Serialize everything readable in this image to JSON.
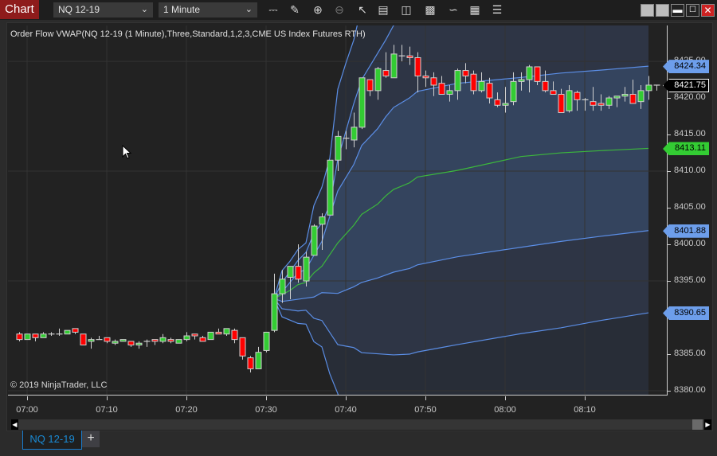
{
  "toolbar": {
    "chart_label": "Chart",
    "instrument": "NQ 12-19",
    "interval": "1 Minute",
    "icons": [
      "bar-type-icon",
      "drawing-tool-icon",
      "zoom-in-icon",
      "zoom-out-icon",
      "pointer-icon",
      "data-box-icon",
      "chart-trader-icon",
      "indicators-icon",
      "strategies-icon",
      "templates-icon",
      "properties-icon"
    ],
    "window_buttons": [
      "restore-icon",
      "restore-icon",
      "minimize-icon",
      "maximize-icon",
      "close-icon"
    ]
  },
  "chart": {
    "indicator_label": "Order Flow VWAP(NQ 12-19 (1 Minute),Three,Standard,1,2,3,CME US Index Futures RTH)",
    "copyright": "© 2019 NinjaTrader, LLC"
  },
  "chart_data": {
    "type": "candlestick",
    "x_range": [
      "06:58",
      "08:20"
    ],
    "ylim": [
      8379.35,
      8429.9
    ],
    "grid": true,
    "x_ticks": [
      "07:00",
      "07:10",
      "07:20",
      "07:30",
      "07:40",
      "07:50",
      "08:00",
      "08:10"
    ],
    "y_ticks": [
      "8380.00",
      "8385.00",
      "8390.00",
      "8395.00",
      "8400.00",
      "8405.00",
      "8410.00",
      "8415.00",
      "8420.00",
      "8425.00"
    ],
    "grid_y": [
      8380,
      8395,
      8410,
      8425
    ],
    "start_time": "06:59",
    "interval_minutes": 1,
    "ohlc": [
      [
        8387.75,
        8388.0,
        8386.75,
        8387.0
      ],
      [
        8387.0,
        8387.75,
        8387.0,
        8387.75
      ],
      [
        8387.75,
        8387.75,
        8386.75,
        8387.25
      ],
      [
        8387.25,
        8388.0,
        8387.25,
        8387.75
      ],
      [
        8387.75,
        8388.0,
        8387.5,
        8387.75
      ],
      [
        8387.75,
        8388.5,
        8387.5,
        8387.75
      ],
      [
        8387.75,
        8388.25,
        8387.75,
        8388.25
      ],
      [
        8388.5,
        8388.5,
        8387.75,
        8388.0
      ],
      [
        8387.75,
        8387.75,
        8386.25,
        8386.25
      ],
      [
        8386.75,
        8387.25,
        8385.75,
        8387.0
      ],
      [
        8387.0,
        8387.5,
        8387.0,
        8387.0
      ],
      [
        8387.25,
        8387.25,
        8386.5,
        8386.75
      ],
      [
        8386.5,
        8387.0,
        8386.25,
        8386.75
      ],
      [
        8386.75,
        8387.0,
        8386.75,
        8387.0
      ],
      [
        8386.75,
        8386.75,
        8386.0,
        8386.25
      ],
      [
        8386.25,
        8386.75,
        8385.75,
        8386.5
      ],
      [
        8386.75,
        8387.0,
        8386.0,
        8386.75
      ],
      [
        8387.0,
        8387.0,
        8386.25,
        8386.75
      ],
      [
        8386.75,
        8387.75,
        8386.5,
        8387.25
      ],
      [
        8387.0,
        8387.25,
        8386.5,
        8386.75
      ],
      [
        8386.5,
        8387.0,
        8386.5,
        8387.0
      ],
      [
        8387.0,
        8388.0,
        8386.75,
        8387.5
      ],
      [
        8387.75,
        8387.75,
        8387.0,
        8387.5
      ],
      [
        8387.25,
        8387.5,
        8386.75,
        8386.75
      ],
      [
        8387.0,
        8388.0,
        8387.0,
        8388.0
      ],
      [
        8388.0,
        8388.5,
        8387.75,
        8387.75
      ],
      [
        8387.75,
        8388.5,
        8387.5,
        8388.5
      ],
      [
        8388.25,
        8388.5,
        8386.5,
        8387.0
      ],
      [
        8387.25,
        8387.25,
        8384.25,
        8384.75
      ],
      [
        8384.5,
        8384.75,
        8382.5,
        8383.0
      ],
      [
        8383.0,
        8386.0,
        8383.0,
        8385.25
      ],
      [
        8385.5,
        8388.0,
        8385.25,
        8388.0
      ],
      [
        8388.25,
        8396.0,
        8388.0,
        8393.25
      ],
      [
        8393.25,
        8396.5,
        8392.0,
        8395.25
      ],
      [
        8395.5,
        8397.0,
        8392.5,
        8397.0
      ],
      [
        8397.0,
        8400.0,
        8394.75,
        8395.25
      ],
      [
        8395.0,
        8399.0,
        8394.25,
        8398.25
      ],
      [
        8398.5,
        8402.75,
        8398.5,
        8402.5
      ],
      [
        8402.75,
        8404.25,
        8399.25,
        8403.75
      ],
      [
        8404.0,
        8411.5,
        8404.0,
        8411.5
      ],
      [
        8411.5,
        8415.5,
        8410.0,
        8414.75
      ],
      [
        8414.5,
        8415.5,
        8413.0,
        8414.5
      ],
      [
        8414.25,
        8418.0,
        8413.25,
        8416.0
      ],
      [
        8416.0,
        8422.75,
        8415.75,
        8422.75
      ],
      [
        8422.5,
        8422.5,
        8420.25,
        8421.0
      ],
      [
        8421.0,
        8424.25,
        8419.75,
        8424.0
      ],
      [
        8423.75,
        8426.25,
        8422.75,
        8423.0
      ],
      [
        8422.75,
        8427.25,
        8422.75,
        8426.0
      ],
      [
        8425.75,
        8427.25,
        8425.0,
        8425.75
      ],
      [
        8425.75,
        8427.0,
        8424.5,
        8425.5
      ],
      [
        8425.5,
        8426.25,
        8420.75,
        8423.0
      ],
      [
        8423.0,
        8423.75,
        8421.5,
        8422.75
      ],
      [
        8422.75,
        8423.5,
        8420.25,
        8421.75
      ],
      [
        8422.0,
        8423.0,
        8420.5,
        8420.5
      ],
      [
        8420.5,
        8421.75,
        8419.5,
        8421.0
      ],
      [
        8421.0,
        8424.0,
        8419.75,
        8423.75
      ],
      [
        8423.75,
        8424.75,
        8422.0,
        8423.0
      ],
      [
        8423.25,
        8423.75,
        8420.5,
        8421.0
      ],
      [
        8421.0,
        8423.5,
        8420.75,
        8422.25
      ],
      [
        8422.0,
        8422.75,
        8419.25,
        8420.0
      ],
      [
        8419.75,
        8420.75,
        8418.75,
        8419.0
      ],
      [
        8419.0,
        8421.5,
        8418.0,
        8419.25
      ],
      [
        8419.5,
        8423.5,
        8419.0,
        8422.25
      ],
      [
        8422.25,
        8423.5,
        8421.0,
        8422.5
      ],
      [
        8422.5,
        8424.5,
        8420.75,
        8424.25
      ],
      [
        8424.25,
        8424.25,
        8421.75,
        8422.25
      ],
      [
        8422.25,
        8423.75,
        8420.75,
        8421.0
      ],
      [
        8421.0,
        8422.25,
        8420.5,
        8420.5
      ],
      [
        8420.5,
        8421.25,
        8418.0,
        8418.0
      ],
      [
        8418.25,
        8421.75,
        8418.0,
        8421.0
      ],
      [
        8420.75,
        8421.0,
        8418.25,
        8419.75
      ],
      [
        8419.75,
        8420.0,
        8418.25,
        8419.75
      ],
      [
        8419.5,
        8421.5,
        8418.25,
        8419.0
      ],
      [
        8419.25,
        8420.5,
        8418.25,
        8419.0
      ],
      [
        8419.0,
        8420.25,
        8418.5,
        8420.0
      ],
      [
        8420.0,
        8420.25,
        8418.75,
        8420.25
      ],
      [
        8420.25,
        8421.5,
        8419.5,
        8420.5
      ],
      [
        8420.5,
        8422.5,
        8419.25,
        8419.25
      ],
      [
        8419.5,
        8421.75,
        8418.5,
        8421.0
      ],
      [
        8421.0,
        8423.0,
        8419.75,
        8421.75
      ],
      [
        8421.75,
        8421.75,
        8421.0,
        8421.75
      ]
    ],
    "bands": {
      "upper_3": {
        "t": [
          "07:31",
          "07:32",
          "07:33",
          "07:34",
          "07:35",
          "07:36",
          "07:37",
          "07:38",
          "07:39",
          "07:40",
          "07:41",
          "07:42"
        ],
        "v": [
          8392.6,
          8396.4,
          8397.7,
          8399.3,
          8400.2,
          8405.3,
          8407.8,
          8411.8,
          8421.2,
          8424.7,
          8427.9,
          8432.5
        ]
      },
      "upper_2": {
        "t": [
          "07:31",
          "07:32",
          "07:34",
          "07:35",
          "07:36",
          "07:37",
          "07:38",
          "07:39",
          "07:41",
          "07:42",
          "07:44",
          "07:45",
          "07:46",
          "07:47"
        ],
        "v": [
          8392.6,
          8394.8,
          8397.8,
          8398.9,
          8401.5,
          8402.9,
          8405.4,
          8411.6,
          8419.2,
          8422.5,
          8426.1,
          8427.9,
          8429.9,
          8432.0
        ]
      },
      "upper_1": {
        "t": [
          "07:31",
          "07:32",
          "07:34",
          "07:35",
          "07:37",
          "07:39",
          "07:41",
          "07:42",
          "07:44",
          "07:45",
          "07:46",
          "07:48",
          "07:49",
          "07:54",
          "08:02",
          "08:07",
          "08:12",
          "08:18"
        ],
        "v": [
          8392.6,
          8393.5,
          8396.1,
          8396.6,
          8400.4,
          8407.3,
          8410.9,
          8413.5,
          8415.8,
          8417.4,
          8418.7,
          8420.0,
          8420.9,
          8422.0,
          8422.8,
          8423.4,
          8423.8,
          8424.34
        ]
      },
      "vwap": {
        "t": [
          "07:31",
          "07:33",
          "07:34",
          "07:35",
          "07:36",
          "07:37",
          "07:38",
          "07:39",
          "07:41",
          "07:42",
          "07:44",
          "07:45",
          "07:46",
          "07:48",
          "07:49",
          "07:54",
          "08:02",
          "08:07",
          "08:12",
          "08:18"
        ],
        "v": [
          8392.6,
          8393.7,
          8394.5,
          8394.8,
          8396.1,
          8397.0,
          8398.6,
          8400.2,
          8402.6,
          8404.1,
          8405.5,
          8406.6,
          8407.5,
          8408.4,
          8409.2,
          8410.1,
          8412.0,
          8412.5,
          8412.8,
          8413.11
        ]
      },
      "lower_1": {
        "t": [
          "07:31",
          "07:32",
          "07:34",
          "07:36",
          "07:37",
          "07:39",
          "07:41",
          "07:42",
          "07:44",
          "07:46",
          "07:48",
          "07:49",
          "07:54",
          "08:02",
          "08:07",
          "08:12",
          "08:18"
        ],
        "v": [
          8392.6,
          8392.2,
          8392.5,
          8392.8,
          8393.4,
          8393.3,
          8394.2,
          8394.8,
          8395.4,
          8396.2,
          8396.7,
          8397.2,
          8398.3,
          8399.6,
          8400.4,
          8401.1,
          8401.88
        ]
      },
      "lower_2": {
        "t": [
          "07:31",
          "07:32",
          "07:34",
          "07:35",
          "07:36",
          "07:37",
          "07:39",
          "07:41",
          "07:42",
          "07:46",
          "07:48",
          "07:49",
          "07:52",
          "07:54",
          "08:02",
          "08:07",
          "08:12",
          "08:18"
        ],
        "v": [
          8392.6,
          8391.2,
          8390.9,
          8391.0,
          8389.9,
          8389.6,
          8386.3,
          8385.9,
          8385.2,
          8384.9,
          8385.0,
          8385.3,
          8385.9,
          8386.3,
          8387.8,
          8388.6,
          8389.6,
          8390.65
        ]
      },
      "lower_3": {
        "t": [
          "07:31",
          "07:32",
          "07:34",
          "07:35",
          "07:36",
          "07:37",
          "07:38",
          "07:39",
          "07:40"
        ],
        "v": [
          8392.6,
          8390.1,
          8389.2,
          8389.1,
          8386.7,
          8386.0,
          8382.3,
          8379.6,
          8376.0
        ]
      }
    },
    "price_markers": [
      {
        "band": "upper_1",
        "label": "8424.34",
        "value": 8424.34,
        "bg": "#6d9eeb",
        "fg": "#000000"
      },
      {
        "band": "last",
        "label": "8421.75",
        "value": 8421.75,
        "bg": "#000000",
        "fg": "#ffffff"
      },
      {
        "band": "vwap",
        "label": "8413.11",
        "value": 8413.11,
        "bg": "#33cc33",
        "fg": "#000000"
      },
      {
        "band": "lower_1",
        "label": "8401.88",
        "value": 8401.88,
        "bg": "#6d9eeb",
        "fg": "#000000"
      },
      {
        "band": "lower_2",
        "label": "8390.65",
        "value": 8390.65,
        "bg": "#6d9eeb",
        "fg": "#000000"
      }
    ],
    "colors": {
      "up": "#33cc33",
      "down": "#ff0000",
      "candle_outline": "#d0d0d0",
      "band_line": "#5b8ee6",
      "vwap_line": "#3cb83c",
      "fill_1": "#34445e",
      "fill_2": "#2e3545",
      "fill_3": "#282d37",
      "grid": "#333333"
    }
  },
  "tabs": [
    {
      "label": "NQ 12-19",
      "active": true
    }
  ],
  "add_tab_label": "+"
}
